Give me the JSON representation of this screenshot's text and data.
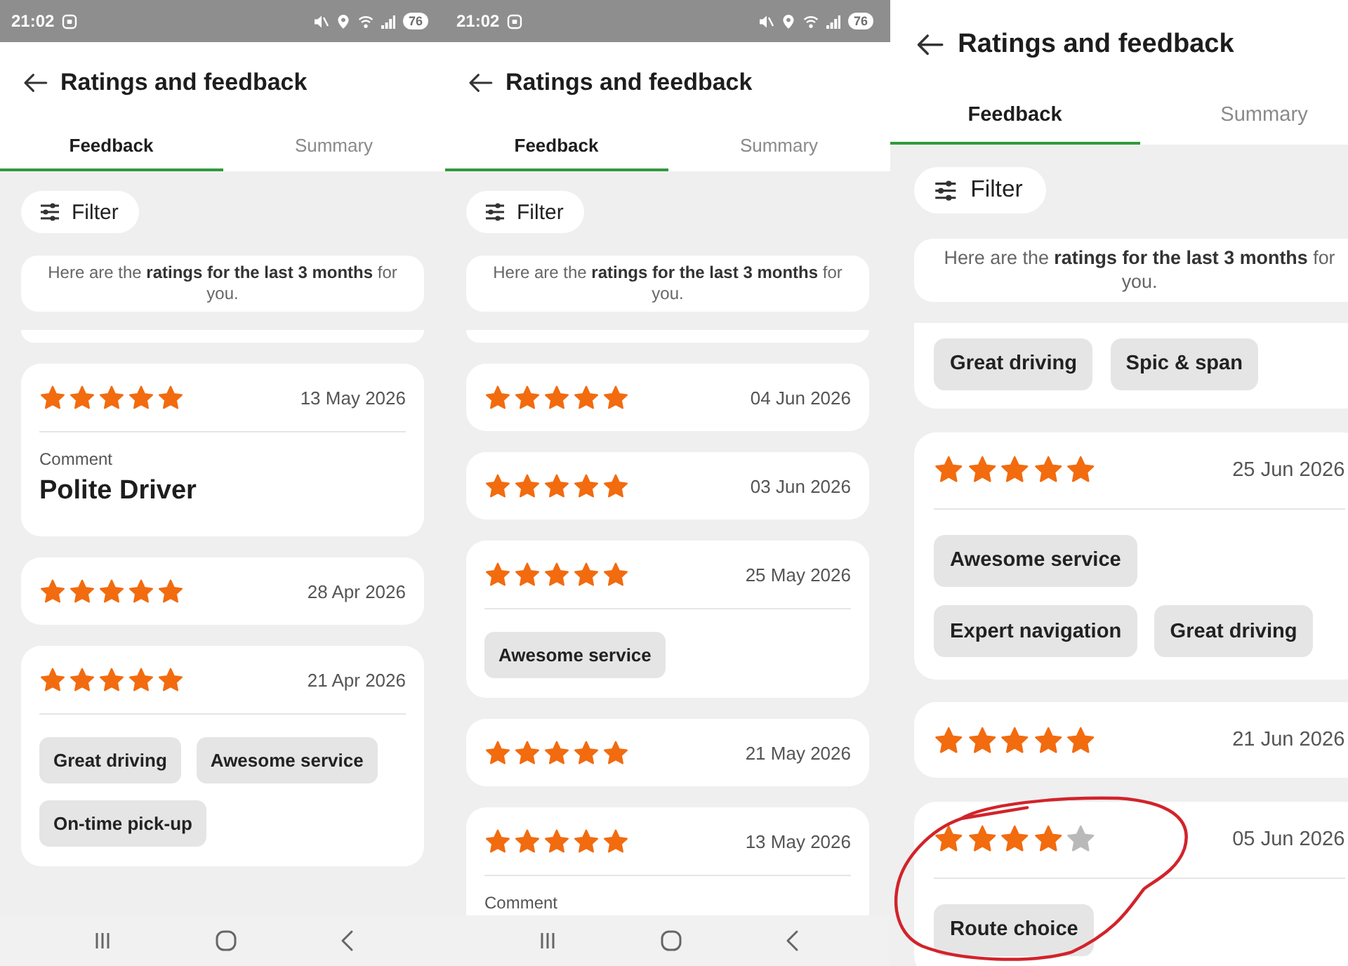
{
  "panels": [
    {
      "kind": "full",
      "status_bar": {
        "time": "21:02",
        "battery": "76"
      },
      "header": {
        "title": "Ratings and feedback"
      },
      "tabs": [
        {
          "label": "Feedback",
          "selected": true
        },
        {
          "label": "Summary",
          "selected": false
        }
      ],
      "filter": {
        "label": "Filter"
      },
      "notice": "Here are the **ratings for the last 3 months** for you.",
      "items": [
        {
          "kind": "clipped",
          "circled": false
        },
        {
          "kind": "rating",
          "stars": 5,
          "date": "13 May 2026",
          "comment_label": "Comment",
          "comment": "Polite Driver",
          "circled": false
        },
        {
          "kind": "rating",
          "stars": 5,
          "date": "28 Apr 2026",
          "circled": false
        },
        {
          "kind": "rating",
          "stars": 5,
          "date": "21 Apr 2026",
          "tags": [
            "Great driving",
            "Awesome service",
            "On-time pick-up"
          ],
          "circled": false
        }
      ]
    },
    {
      "kind": "full",
      "status_bar": {
        "time": "21:02",
        "battery": "76"
      },
      "header": {
        "title": "Ratings and feedback"
      },
      "tabs": [
        {
          "label": "Feedback",
          "selected": true
        },
        {
          "label": "Summary",
          "selected": false
        }
      ],
      "filter": {
        "label": "Filter"
      },
      "notice": "Here are the **ratings for the last 3 months** for you.",
      "items": [
        {
          "kind": "clipped",
          "circled": false
        },
        {
          "kind": "rating",
          "stars": 5,
          "date": "04 Jun 2026",
          "circled": false
        },
        {
          "kind": "rating",
          "stars": 5,
          "date": "03 Jun 2026",
          "circled": false
        },
        {
          "kind": "rating",
          "stars": 5,
          "date": "25 May 2026",
          "tags": [
            "Awesome service"
          ],
          "circled": false
        },
        {
          "kind": "rating",
          "stars": 5,
          "date": "21 May 2026",
          "circled": false
        },
        {
          "kind": "rating",
          "stars": 5,
          "date": "13 May 2026",
          "comment_label": "Comment",
          "circled": false
        }
      ]
    },
    {
      "kind": "zoomed",
      "header": {
        "title": "Ratings and feedback"
      },
      "tabs": [
        {
          "label": "Feedback",
          "selected": true
        },
        {
          "label": "Summary",
          "selected": false
        }
      ],
      "filter": {
        "label": "Filter"
      },
      "notice": "Here are the **ratings for the last 3 months** for you.",
      "items": [
        {
          "kind": "clipped",
          "tags": [
            "Great driving",
            "Spic & span"
          ],
          "circled": false
        },
        {
          "kind": "rating",
          "stars": 5,
          "date": "25 Jun 2026",
          "tags": [
            "Awesome service",
            "Expert navigation",
            "Great driving"
          ],
          "circled": false
        },
        {
          "kind": "rating",
          "stars": 5,
          "date": "21 Jun 2026",
          "circled": false
        },
        {
          "kind": "rating",
          "stars": 4,
          "date": "05 Jun 2026",
          "tags": [
            "Route choice"
          ],
          "circled": true
        }
      ]
    }
  ]
}
